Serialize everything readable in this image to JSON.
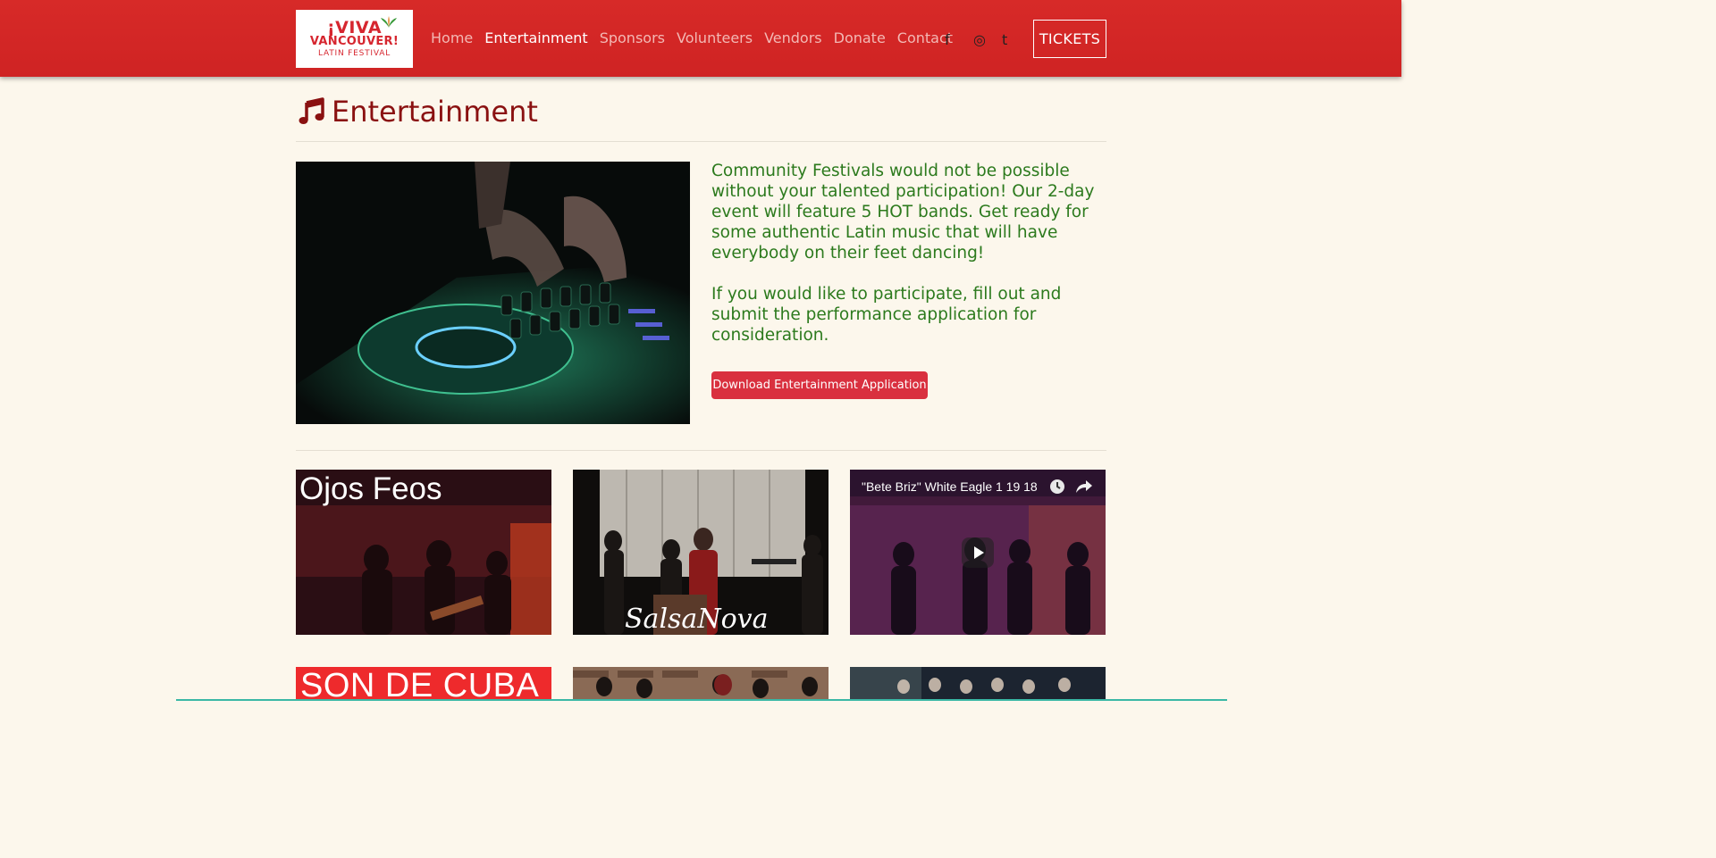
{
  "header": {
    "logo": {
      "line1": "¡VIVA",
      "line2": "VANCOUVER!",
      "line3": "LATIN FESTIVAL"
    },
    "nav": [
      {
        "label": "Home",
        "active": false
      },
      {
        "label": "Entertainment",
        "active": true
      },
      {
        "label": "Sponsors",
        "active": false
      },
      {
        "label": "Volunteers",
        "active": false
      },
      {
        "label": "Vendors",
        "active": false
      },
      {
        "label": "Donate",
        "active": false
      },
      {
        "label": "Contact",
        "active": false
      }
    ],
    "social": [
      {
        "icon": "facebook-icon",
        "glyph": "f"
      },
      {
        "icon": "instagram-icon",
        "glyph": "◎"
      },
      {
        "icon": "twitter-icon",
        "glyph": "t"
      }
    ],
    "tickets_label": "TICKETS"
  },
  "page": {
    "title": "Entertainment",
    "title_icon": "music-note-icon",
    "intro_paragraphs": [
      "Community Festivals would not be possible without your talented participation! Our 2-day event will feature 5 HOT bands. Get ready for some authentic Latin music that will have everybody on their feet dancing!",
      "If you would like to participate, fill out and submit the performance application for consideration."
    ],
    "download_button": "Download Entertainment Application"
  },
  "bands": [
    {
      "label": "Ojos Feos"
    },
    {
      "label": "SalsaNova"
    },
    {
      "label": "\"Bete Briz\" White Eagle 1 19 18"
    },
    {
      "label": "SON DE CUBA"
    },
    {
      "label": ""
    },
    {
      "label": ""
    }
  ],
  "colors": {
    "header_red": "#d42a28",
    "background": "#fcf7ec",
    "title": "#8a1111",
    "intro_text": "#2c7a1d",
    "button": "#d9303f"
  }
}
